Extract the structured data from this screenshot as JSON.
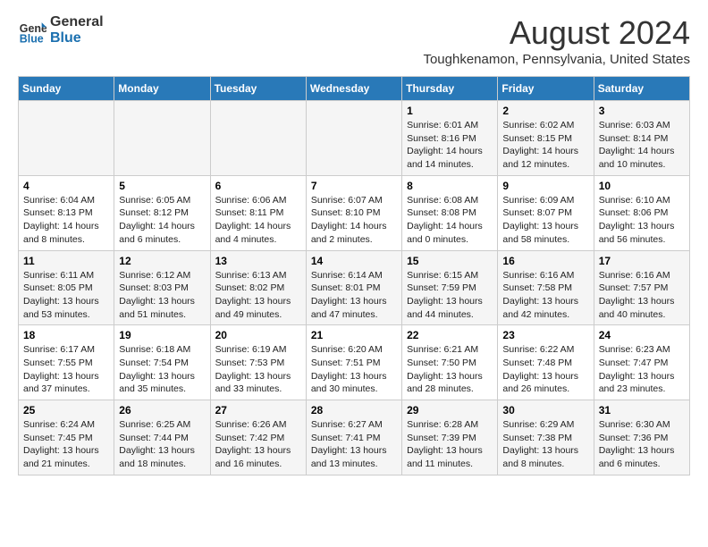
{
  "header": {
    "logo_line1": "General",
    "logo_line2": "Blue",
    "month_year": "August 2024",
    "location": "Toughkenamon, Pennsylvania, United States"
  },
  "weekdays": [
    "Sunday",
    "Monday",
    "Tuesday",
    "Wednesday",
    "Thursday",
    "Friday",
    "Saturday"
  ],
  "weeks": [
    [
      {
        "day": "",
        "info": ""
      },
      {
        "day": "",
        "info": ""
      },
      {
        "day": "",
        "info": ""
      },
      {
        "day": "",
        "info": ""
      },
      {
        "day": "1",
        "info": "Sunrise: 6:01 AM\nSunset: 8:16 PM\nDaylight: 14 hours\nand 14 minutes."
      },
      {
        "day": "2",
        "info": "Sunrise: 6:02 AM\nSunset: 8:15 PM\nDaylight: 14 hours\nand 12 minutes."
      },
      {
        "day": "3",
        "info": "Sunrise: 6:03 AM\nSunset: 8:14 PM\nDaylight: 14 hours\nand 10 minutes."
      }
    ],
    [
      {
        "day": "4",
        "info": "Sunrise: 6:04 AM\nSunset: 8:13 PM\nDaylight: 14 hours\nand 8 minutes."
      },
      {
        "day": "5",
        "info": "Sunrise: 6:05 AM\nSunset: 8:12 PM\nDaylight: 14 hours\nand 6 minutes."
      },
      {
        "day": "6",
        "info": "Sunrise: 6:06 AM\nSunset: 8:11 PM\nDaylight: 14 hours\nand 4 minutes."
      },
      {
        "day": "7",
        "info": "Sunrise: 6:07 AM\nSunset: 8:10 PM\nDaylight: 14 hours\nand 2 minutes."
      },
      {
        "day": "8",
        "info": "Sunrise: 6:08 AM\nSunset: 8:08 PM\nDaylight: 14 hours\nand 0 minutes."
      },
      {
        "day": "9",
        "info": "Sunrise: 6:09 AM\nSunset: 8:07 PM\nDaylight: 13 hours\nand 58 minutes."
      },
      {
        "day": "10",
        "info": "Sunrise: 6:10 AM\nSunset: 8:06 PM\nDaylight: 13 hours\nand 56 minutes."
      }
    ],
    [
      {
        "day": "11",
        "info": "Sunrise: 6:11 AM\nSunset: 8:05 PM\nDaylight: 13 hours\nand 53 minutes."
      },
      {
        "day": "12",
        "info": "Sunrise: 6:12 AM\nSunset: 8:03 PM\nDaylight: 13 hours\nand 51 minutes."
      },
      {
        "day": "13",
        "info": "Sunrise: 6:13 AM\nSunset: 8:02 PM\nDaylight: 13 hours\nand 49 minutes."
      },
      {
        "day": "14",
        "info": "Sunrise: 6:14 AM\nSunset: 8:01 PM\nDaylight: 13 hours\nand 47 minutes."
      },
      {
        "day": "15",
        "info": "Sunrise: 6:15 AM\nSunset: 7:59 PM\nDaylight: 13 hours\nand 44 minutes."
      },
      {
        "day": "16",
        "info": "Sunrise: 6:16 AM\nSunset: 7:58 PM\nDaylight: 13 hours\nand 42 minutes."
      },
      {
        "day": "17",
        "info": "Sunrise: 6:16 AM\nSunset: 7:57 PM\nDaylight: 13 hours\nand 40 minutes."
      }
    ],
    [
      {
        "day": "18",
        "info": "Sunrise: 6:17 AM\nSunset: 7:55 PM\nDaylight: 13 hours\nand 37 minutes."
      },
      {
        "day": "19",
        "info": "Sunrise: 6:18 AM\nSunset: 7:54 PM\nDaylight: 13 hours\nand 35 minutes."
      },
      {
        "day": "20",
        "info": "Sunrise: 6:19 AM\nSunset: 7:53 PM\nDaylight: 13 hours\nand 33 minutes."
      },
      {
        "day": "21",
        "info": "Sunrise: 6:20 AM\nSunset: 7:51 PM\nDaylight: 13 hours\nand 30 minutes."
      },
      {
        "day": "22",
        "info": "Sunrise: 6:21 AM\nSunset: 7:50 PM\nDaylight: 13 hours\nand 28 minutes."
      },
      {
        "day": "23",
        "info": "Sunrise: 6:22 AM\nSunset: 7:48 PM\nDaylight: 13 hours\nand 26 minutes."
      },
      {
        "day": "24",
        "info": "Sunrise: 6:23 AM\nSunset: 7:47 PM\nDaylight: 13 hours\nand 23 minutes."
      }
    ],
    [
      {
        "day": "25",
        "info": "Sunrise: 6:24 AM\nSunset: 7:45 PM\nDaylight: 13 hours\nand 21 minutes."
      },
      {
        "day": "26",
        "info": "Sunrise: 6:25 AM\nSunset: 7:44 PM\nDaylight: 13 hours\nand 18 minutes."
      },
      {
        "day": "27",
        "info": "Sunrise: 6:26 AM\nSunset: 7:42 PM\nDaylight: 13 hours\nand 16 minutes."
      },
      {
        "day": "28",
        "info": "Sunrise: 6:27 AM\nSunset: 7:41 PM\nDaylight: 13 hours\nand 13 minutes."
      },
      {
        "day": "29",
        "info": "Sunrise: 6:28 AM\nSunset: 7:39 PM\nDaylight: 13 hours\nand 11 minutes."
      },
      {
        "day": "30",
        "info": "Sunrise: 6:29 AM\nSunset: 7:38 PM\nDaylight: 13 hours\nand 8 minutes."
      },
      {
        "day": "31",
        "info": "Sunrise: 6:30 AM\nSunset: 7:36 PM\nDaylight: 13 hours\nand 6 minutes."
      }
    ]
  ]
}
